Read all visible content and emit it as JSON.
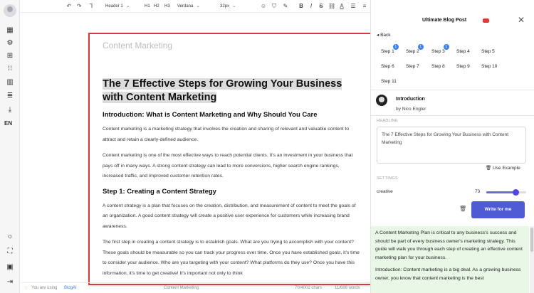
{
  "toolbar": {
    "style": "Header 1",
    "h1": "H1",
    "h2": "H2",
    "h3": "H3",
    "font": "Verdana",
    "size": "32px"
  },
  "sidebar": {
    "lang": "EN"
  },
  "document": {
    "title_placeholder": "Content Marketing",
    "heading": "The 7 Effective Steps for Growing Your Business with Content Marketing",
    "intro_heading": "Introduction: What is Content Marketing and Why Should You Care",
    "intro_p1": "Content marketing is a marketing strategy that involves the creation and sharing of relevant and valuable content to attract and retain a clearly-defined audience.",
    "intro_p2": "Content marketing is one of the most effective ways to reach potential clients. It's an investment in your business that pays off in many ways. A strong content strategy can lead to more conversions, higher search engine rankings, increased traffic, and improved customer retention rates.",
    "step1_heading": "Step 1: Creating a Content Strategy",
    "step1_p1": "A content strategy is a plan that focuses on the creation, distribution, and measurement of content to meet the goals of an organization. A good content strategy will create a positive user experience for customers while increasing brand awareness.",
    "step1_p2": "The first step in creating a content strategy is to establish goals. What are you trying to accomplish with your content? These goals should be measurable so you can track your progress over time. Once you have established goals, it's time to consider your audience. Who are you targeting with your content? What platforms do they use? Once you have this information, it's time to get creative! It's important not only to think"
  },
  "status": {
    "using_prefix": "You are using",
    "brand": "BlogAI",
    "doc_name": "Content Marketing",
    "chars": "70/4002 chars",
    "words": "11/686 words"
  },
  "panel": {
    "title": "Ultimate Blog Post",
    "back": "Back",
    "steps": [
      {
        "label": "Step 1",
        "badge": "1"
      },
      {
        "label": "Step 2",
        "badge": "1"
      },
      {
        "label": "Step 3",
        "badge": "1"
      },
      {
        "label": "Step 4"
      },
      {
        "label": "Step 5"
      },
      {
        "label": "Step 6"
      },
      {
        "label": "Step 7"
      },
      {
        "label": "Step 8"
      },
      {
        "label": "Step 9"
      },
      {
        "label": "Step 10"
      },
      {
        "label": "Step 11"
      }
    ],
    "template_name": "Introduction",
    "byline": "by Nico Engler",
    "headline_label": "HEADLINE",
    "headline_value": "The 7 Effective Steps for Growing Your Business with Content Marketing",
    "use_example": "Use Example",
    "settings_label": "SETTINGS",
    "creative_label": "creative",
    "creative_value": 73,
    "creative_fraction": 0.73,
    "write_button": "Write for me",
    "output_p1": "A Content Marketing Plan is critical to any business's success and should be part of every business owner's marketing strategy. This guide will walk you through each step of creating an effective content marketing plan for your business.",
    "output_p2": "Introduction: Content marketing is a big deal. As a growing business owner, you know that content marketing is the best"
  }
}
